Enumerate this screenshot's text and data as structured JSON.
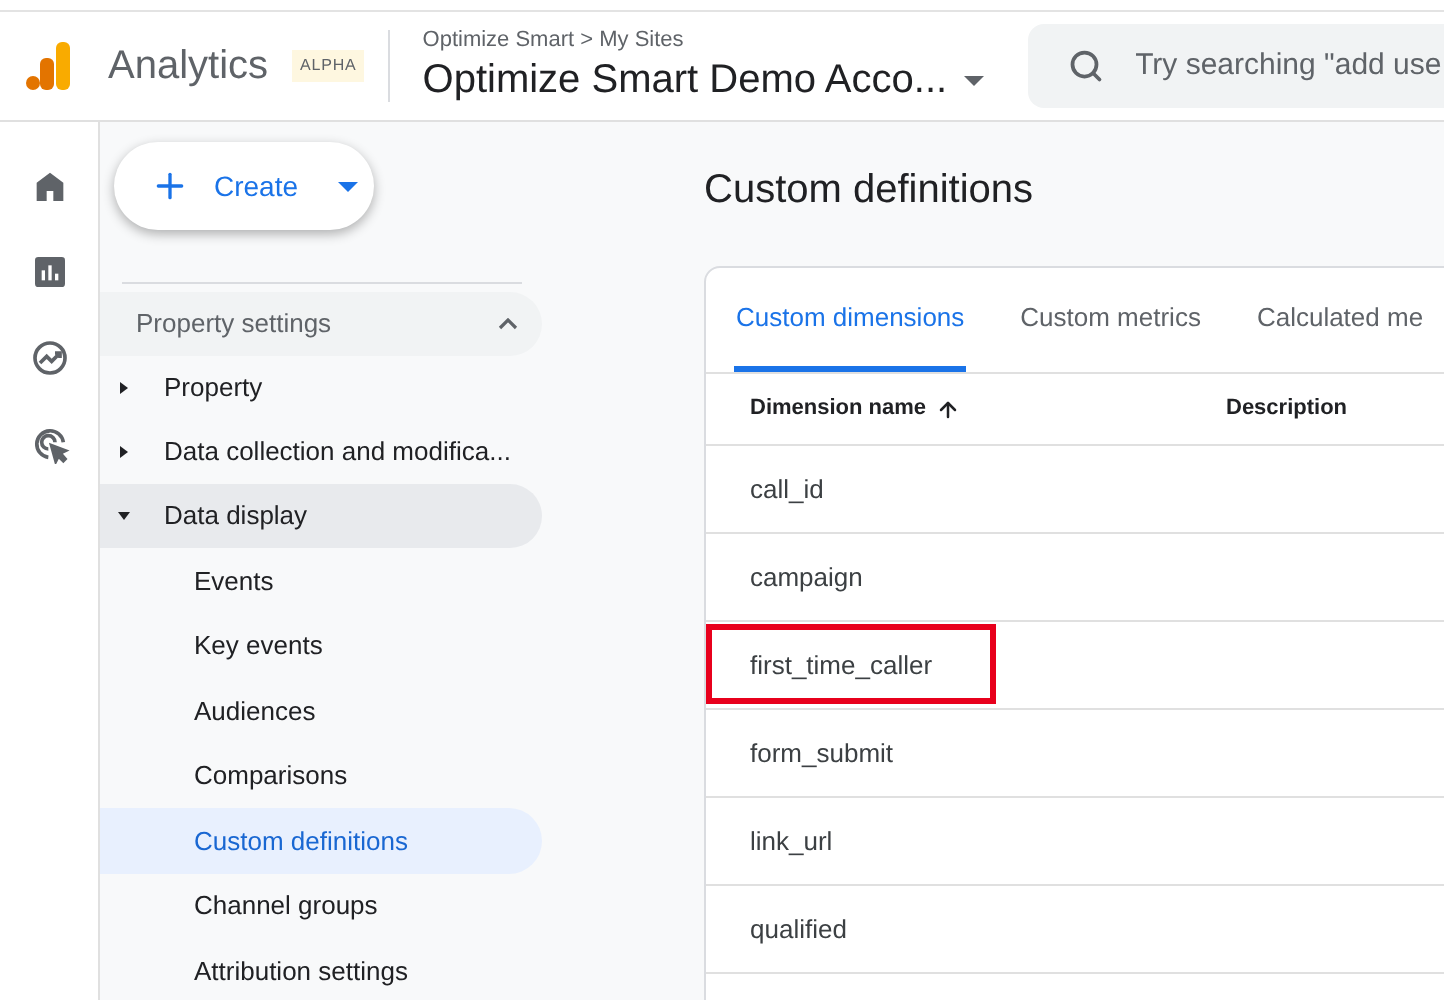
{
  "header": {
    "product": "Analytics",
    "badge": "ALPHA",
    "breadcrumb": "Optimize Smart > My Sites",
    "account": "Optimize Smart Demo Acco...",
    "search": {
      "placeholder": "Try searching \"add use"
    }
  },
  "rail": [
    {
      "kind": "home",
      "selected": false
    },
    {
      "kind": "reports",
      "selected": false
    },
    {
      "kind": "explore",
      "selected": false
    },
    {
      "kind": "advertising",
      "selected": false
    }
  ],
  "create_button": {
    "label": "Create"
  },
  "sidebar": {
    "section": {
      "label": "Property settings",
      "expanded": true
    },
    "items": [
      {
        "label": "Property",
        "expanded": false
      },
      {
        "label": "Data collection and modifica...",
        "expanded": false
      },
      {
        "label": "Data display",
        "expanded": true,
        "children": [
          {
            "label": "Events",
            "selected": false
          },
          {
            "label": "Key events",
            "selected": false
          },
          {
            "label": "Audiences",
            "selected": false
          },
          {
            "label": "Comparisons",
            "selected": false
          },
          {
            "label": "Custom definitions",
            "selected": true
          },
          {
            "label": "Channel groups",
            "selected": false
          },
          {
            "label": "Attribution settings",
            "selected": false
          }
        ]
      }
    ]
  },
  "page_title": "Custom definitions",
  "tabs": [
    {
      "label": "Custom dimensions",
      "selected": true
    },
    {
      "label": "Custom metrics",
      "selected": false
    },
    {
      "label": "Calculated me",
      "selected": false
    }
  ],
  "table": {
    "columns": [
      "Dimension name",
      "Description"
    ],
    "rows": [
      {
        "name": "call_id",
        "highlighted": false
      },
      {
        "name": "campaign",
        "highlighted": false
      },
      {
        "name": "first_time_caller",
        "highlighted": true
      },
      {
        "name": "form_submit",
        "highlighted": false
      },
      {
        "name": "link_url",
        "highlighted": false
      },
      {
        "name": "qualified",
        "highlighted": false
      }
    ]
  }
}
